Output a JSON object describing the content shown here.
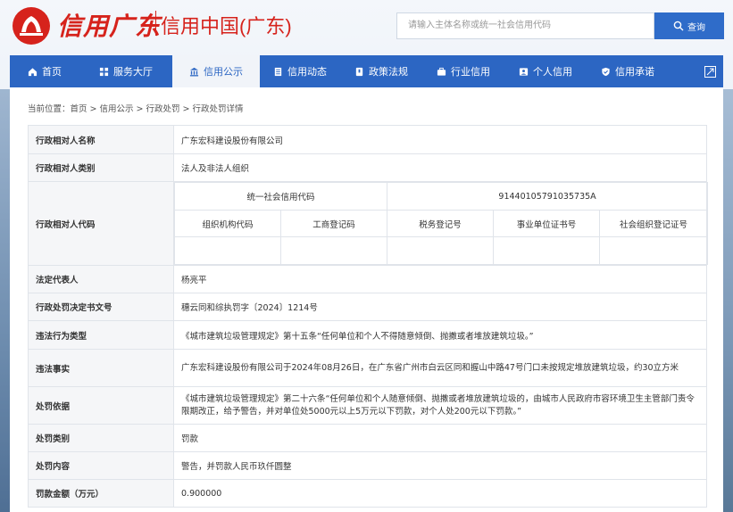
{
  "header": {
    "logo_text": "信用广东",
    "site_title": "信用中国(广东)",
    "search_placeholder": "请输入主体名称或统一社会信用代码",
    "search_button": "查询"
  },
  "nav": {
    "items": [
      {
        "label": "首页",
        "icon": "home-icon"
      },
      {
        "label": "服务大厅",
        "icon": "grid-icon"
      },
      {
        "label": "信用公示",
        "icon": "bank-icon",
        "active": true
      },
      {
        "label": "信用动态",
        "icon": "document-icon"
      },
      {
        "label": "政策法规",
        "icon": "book-icon"
      },
      {
        "label": "行业信用",
        "icon": "briefcase-icon"
      },
      {
        "label": "个人信用",
        "icon": "id-card-icon"
      },
      {
        "label": "信用承诺",
        "icon": "shield-check-icon"
      }
    ],
    "expand_icon": "expand-icon"
  },
  "breadcrumb": {
    "prefix": "当前位置：",
    "path": "首页 > 信用公示 > 行政处罚 > 行政处罚详情"
  },
  "detail": {
    "party_name_label": "行政相对人名称",
    "party_name": "广东宏科建设股份有限公司",
    "party_type_label": "行政相对人类别",
    "party_type": "法人及非法人组织",
    "party_code_label": "行政相对人代码",
    "uscc_label": "统一社会信用代码",
    "uscc_value": "91440105791035735A",
    "code_headers": [
      "组织机构代码",
      "工商登记码",
      "税务登记号",
      "事业单位证书号",
      "社会组织登记证号"
    ],
    "code_values": [
      "",
      "",
      "",
      "",
      ""
    ],
    "legal_rep_label": "法定代表人",
    "legal_rep": "杨亮平",
    "decision_no_label": "行政处罚决定书文号",
    "decision_no": "穗云同和综执罚字〔2024〕1214号",
    "violation_type_label": "违法行为类型",
    "violation_type": "《城市建筑垃圾管理规定》第十五条“任何单位和个人不得随意倾倒、抛撒或者堆放建筑垃圾。”",
    "violation_fact_label": "违法事实",
    "violation_fact": "广东宏科建设股份有限公司于2024年08月26日，在广东省广州市白云区同和握山中路47号门口未按规定堆放建筑垃圾，约30立方米",
    "basis_label": "处罚依据",
    "basis": "《城市建筑垃圾管理规定》第二十六条“任何单位和个人随意倾倒、抛撒或者堆放建筑垃圾的，由城市人民政府市容环境卫生主管部门责令限期改正，给予警告，并对单位处5000元以上5万元以下罚款，对个人处200元以下罚款。”",
    "penalty_type_label": "处罚类别",
    "penalty_type": "罚款",
    "penalty_content_label": "处罚内容",
    "penalty_content": "警告，并罚款人民币玖仟圆整",
    "fine_label": "罚款金额（万元）",
    "fine": "0.900000"
  },
  "colors": {
    "brand_red": "#d6231c",
    "nav_blue": "#2c66c3",
    "search_blue": "#2f6cc9"
  }
}
